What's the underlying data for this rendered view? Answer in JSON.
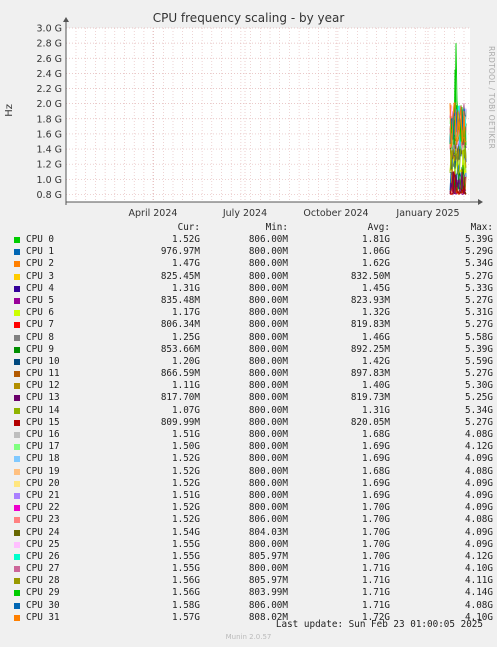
{
  "title": "CPU frequency scaling - by year",
  "side_label": "RRDTOOL / TOBI OETIKER",
  "footer": "Last update: Sun Feb 23 01:00:05 2025",
  "munin": "Munin 2.0.57",
  "chart_data": {
    "type": "line",
    "ylabel": "Hz",
    "ylim": [
      0.7,
      3.0
    ],
    "yticks": [
      "3.0 G",
      "2.8 G",
      "2.6 G",
      "2.4 G",
      "2.2 G",
      "2.0 G",
      "1.8 G",
      "1.6 G",
      "1.4 G",
      "1.2 G",
      "1.0 G",
      "0.8 G"
    ],
    "ytick_values": [
      3.0,
      2.8,
      2.6,
      2.4,
      2.2,
      2.0,
      1.8,
      1.6,
      1.4,
      1.2,
      1.0,
      0.8
    ],
    "xticks": [
      "April 2024",
      "July 2024",
      "October 2024",
      "January 2025"
    ],
    "grid": true,
    "legend_headers": [
      "Cur:",
      "Min:",
      "Avg:",
      "Max:"
    ],
    "series": [
      {
        "name": "CPU 0",
        "color": "#00cc00",
        "cur": "1.52G",
        "min": "806.00M",
        "avg": "1.81G",
        "max": "5.39G"
      },
      {
        "name": "CPU 1",
        "color": "#0066b3",
        "cur": "976.97M",
        "min": "800.00M",
        "avg": "1.06G",
        "max": "5.29G"
      },
      {
        "name": "CPU 2",
        "color": "#ff8000",
        "cur": "1.47G",
        "min": "800.00M",
        "avg": "1.62G",
        "max": "5.34G"
      },
      {
        "name": "CPU 3",
        "color": "#ffcc00",
        "cur": "825.45M",
        "min": "800.00M",
        "avg": "832.50M",
        "max": "5.27G"
      },
      {
        "name": "CPU 4",
        "color": "#330099",
        "cur": "1.31G",
        "min": "800.00M",
        "avg": "1.45G",
        "max": "5.33G"
      },
      {
        "name": "CPU 5",
        "color": "#990099",
        "cur": "835.48M",
        "min": "800.00M",
        "avg": "823.93M",
        "max": "5.27G"
      },
      {
        "name": "CPU 6",
        "color": "#ccff00",
        "cur": "1.17G",
        "min": "800.00M",
        "avg": "1.32G",
        "max": "5.31G"
      },
      {
        "name": "CPU 7",
        "color": "#ff0000",
        "cur": "806.34M",
        "min": "800.00M",
        "avg": "819.83M",
        "max": "5.27G"
      },
      {
        "name": "CPU 8",
        "color": "#808080",
        "cur": "1.25G",
        "min": "800.00M",
        "avg": "1.46G",
        "max": "5.58G"
      },
      {
        "name": "CPU 9",
        "color": "#008f00",
        "cur": "853.66M",
        "min": "800.00M",
        "avg": "892.25M",
        "max": "5.39G"
      },
      {
        "name": "CPU 10",
        "color": "#00487d",
        "cur": "1.20G",
        "min": "800.00M",
        "avg": "1.42G",
        "max": "5.59G"
      },
      {
        "name": "CPU 11",
        "color": "#b35a00",
        "cur": "866.59M",
        "min": "800.00M",
        "avg": "897.83M",
        "max": "5.27G"
      },
      {
        "name": "CPU 12",
        "color": "#b38f00",
        "cur": "1.11G",
        "min": "800.00M",
        "avg": "1.40G",
        "max": "5.30G"
      },
      {
        "name": "CPU 13",
        "color": "#6b006b",
        "cur": "817.70M",
        "min": "800.00M",
        "avg": "819.73M",
        "max": "5.25G"
      },
      {
        "name": "CPU 14",
        "color": "#8fb300",
        "cur": "1.07G",
        "min": "800.00M",
        "avg": "1.31G",
        "max": "5.34G"
      },
      {
        "name": "CPU 15",
        "color": "#b30000",
        "cur": "809.99M",
        "min": "800.00M",
        "avg": "820.05M",
        "max": "5.27G"
      },
      {
        "name": "CPU 16",
        "color": "#bebebe",
        "cur": "1.51G",
        "min": "800.00M",
        "avg": "1.68G",
        "max": "4.08G"
      },
      {
        "name": "CPU 17",
        "color": "#80ff80",
        "cur": "1.50G",
        "min": "800.00M",
        "avg": "1.69G",
        "max": "4.12G"
      },
      {
        "name": "CPU 18",
        "color": "#80c9ff",
        "cur": "1.52G",
        "min": "800.00M",
        "avg": "1.69G",
        "max": "4.09G"
      },
      {
        "name": "CPU 19",
        "color": "#ffc080",
        "cur": "1.52G",
        "min": "800.00M",
        "avg": "1.68G",
        "max": "4.08G"
      },
      {
        "name": "CPU 20",
        "color": "#ffe680",
        "cur": "1.52G",
        "min": "800.00M",
        "avg": "1.69G",
        "max": "4.09G"
      },
      {
        "name": "CPU 21",
        "color": "#aa80ff",
        "cur": "1.51G",
        "min": "800.00M",
        "avg": "1.69G",
        "max": "4.09G"
      },
      {
        "name": "CPU 22",
        "color": "#ee00cc",
        "cur": "1.52G",
        "min": "800.00M",
        "avg": "1.70G",
        "max": "4.09G"
      },
      {
        "name": "CPU 23",
        "color": "#ff8080",
        "cur": "1.52G",
        "min": "806.00M",
        "avg": "1.70G",
        "max": "4.08G"
      },
      {
        "name": "CPU 24",
        "color": "#666600",
        "cur": "1.54G",
        "min": "804.03M",
        "avg": "1.70G",
        "max": "4.09G"
      },
      {
        "name": "CPU 25",
        "color": "#ffbfff",
        "cur": "1.55G",
        "min": "800.00M",
        "avg": "1.70G",
        "max": "4.09G"
      },
      {
        "name": "CPU 26",
        "color": "#00ffcc",
        "cur": "1.55G",
        "min": "805.97M",
        "avg": "1.70G",
        "max": "4.12G"
      },
      {
        "name": "CPU 27",
        "color": "#cc6699",
        "cur": "1.55G",
        "min": "800.00M",
        "avg": "1.71G",
        "max": "4.10G"
      },
      {
        "name": "CPU 28",
        "color": "#999900",
        "cur": "1.56G",
        "min": "805.97M",
        "avg": "1.71G",
        "max": "4.11G"
      },
      {
        "name": "CPU 29",
        "color": "#00cc00",
        "cur": "1.56G",
        "min": "803.99M",
        "avg": "1.71G",
        "max": "4.14G"
      },
      {
        "name": "CPU 30",
        "color": "#0066b3",
        "cur": "1.58G",
        "min": "806.00M",
        "avg": "1.71G",
        "max": "4.08G"
      },
      {
        "name": "CPU 31",
        "color": "#ff8000",
        "cur": "1.57G",
        "min": "808.02M",
        "avg": "1.72G",
        "max": "4.10G"
      }
    ]
  }
}
